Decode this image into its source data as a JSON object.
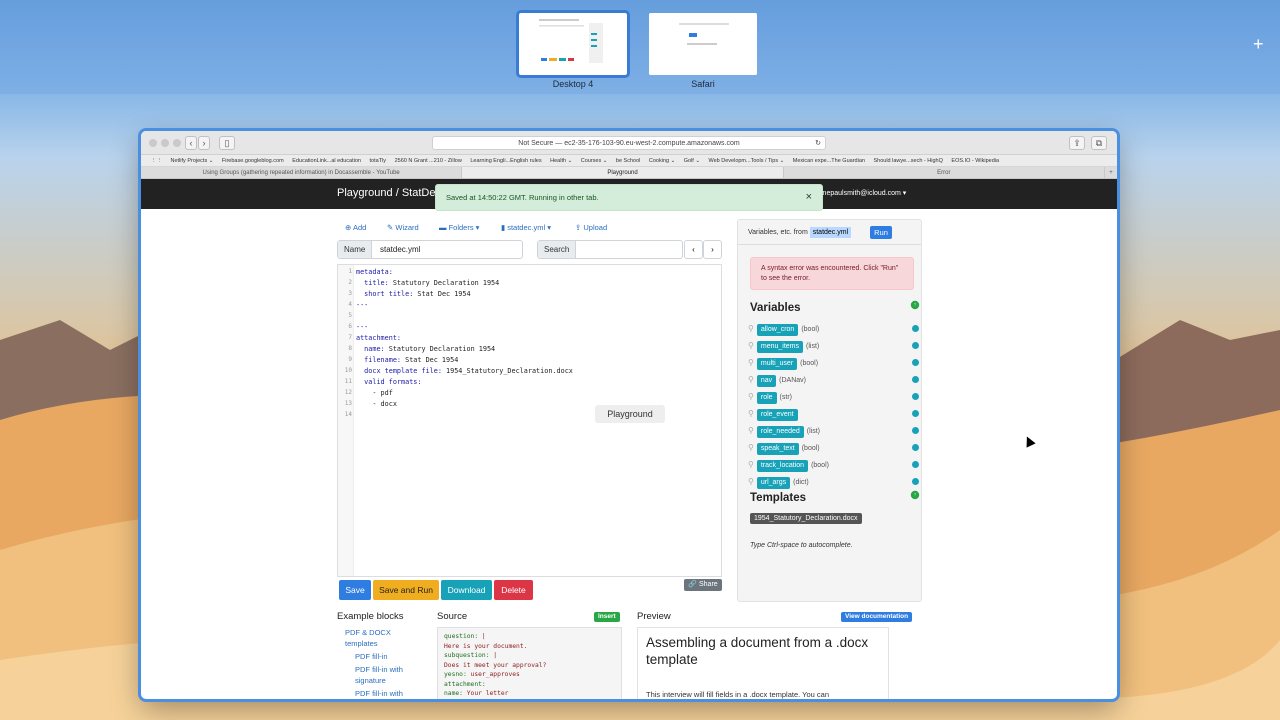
{
  "spaces": {
    "desktop_label": "Desktop 4",
    "safari_label": "Safari",
    "add_symbol": "+"
  },
  "browser": {
    "url": "Not Secure — ec2-35-176-103-90.eu-west-2.compute.amazonaws.com",
    "favorites": [
      "Netlify Projects ⌄",
      "Firebase.googleblog.com",
      "EducationLink...al education",
      "totaTly",
      "2560 N Grant ...210 - Zillow",
      "Learning Engli...English rules",
      "Health ⌄",
      "Courses ⌄",
      "be School",
      "Cooking ⌄",
      "Golf ⌄",
      "Web Developm...Tools / Tips ⌄",
      "Mexican expe...The Guardian",
      "Should lawye...sech - HighQ",
      "EOS.IO - Wikipedia"
    ],
    "tabs": [
      "Using Groups (gathering repeated information) in Docassemble - YouTube",
      "Playground",
      "Error"
    ]
  },
  "navbar": {
    "brand": "Playground / StatDec",
    "user": "inepaulsmith@icloud.com ▾"
  },
  "toast": {
    "message": "Saved at 14:50:22 GMT. Running in other tab.",
    "close": "×"
  },
  "toolbar": {
    "add": "Add",
    "wizard": "Wizard",
    "folders": "Folders ▾",
    "file": "statdec.yml ▾",
    "upload": "Upload"
  },
  "name_field": {
    "label": "Name",
    "value": "statdec.yml"
  },
  "search_field": {
    "label": "Search",
    "value": ""
  },
  "editor": {
    "lines": [
      {
        "n": "1",
        "k": "metadata:",
        "v": ""
      },
      {
        "n": "2",
        "k": "  title:",
        "v": " Statutory Declaration 1954"
      },
      {
        "n": "3",
        "k": "  short title:",
        "v": " Stat Dec 1954"
      },
      {
        "n": "4",
        "k": "---",
        "v": ""
      },
      {
        "n": "5",
        "k": "",
        "v": ""
      },
      {
        "n": "6",
        "k": "---",
        "v": ""
      },
      {
        "n": "7",
        "k": "attachment:",
        "v": ""
      },
      {
        "n": "8",
        "k": "  name:",
        "v": " Statutory Declaration 1954"
      },
      {
        "n": "9",
        "k": "  filename:",
        "v": " Stat Dec 1954"
      },
      {
        "n": "10",
        "k": "  docx template file:",
        "v": " 1954_Statutory_Declaration.docx"
      },
      {
        "n": "11",
        "k": "  valid formats:",
        "v": ""
      },
      {
        "n": "12",
        "k": "",
        "v": "    - pdf"
      },
      {
        "n": "13",
        "k": "",
        "v": "    - docx"
      },
      {
        "n": "14",
        "k": "",
        "v": ""
      }
    ],
    "tooltip": "Playground"
  },
  "buttons": {
    "save": "Save",
    "save_run": "Save and Run",
    "download": "Download",
    "delete": "Delete",
    "share": "Share"
  },
  "sidebar": {
    "head_text": "Variables, etc. from",
    "file_chip": "statdec.yml",
    "run": "Run",
    "alert": "A syntax error was encountered. Click \"Run\" to see the error.",
    "variables_title": "Variables",
    "variables": [
      {
        "name": "allow_cron",
        "type": "(bool)"
      },
      {
        "name": "menu_items",
        "type": "(list)"
      },
      {
        "name": "multi_user",
        "type": "(bool)"
      },
      {
        "name": "nav",
        "type": "(DANav)"
      },
      {
        "name": "role",
        "type": "(str)"
      },
      {
        "name": "role_event",
        "type": ""
      },
      {
        "name": "role_needed",
        "type": "(list)"
      },
      {
        "name": "speak_text",
        "type": "(bool)"
      },
      {
        "name": "track_location",
        "type": "(bool)"
      },
      {
        "name": "url_args",
        "type": "(dict)"
      }
    ],
    "templates_title": "Templates",
    "template_file": "1954_Statutory_Declaration.docx",
    "hint": "Type Ctrl-space to autocomplete."
  },
  "examples": {
    "title": "Example blocks",
    "category": "PDF & DOCX templates",
    "items": [
      "PDF fill-in",
      "PDF fill-in with signature",
      "PDF fill-in with"
    ]
  },
  "source": {
    "title": "Source",
    "insert": "Insert",
    "lines": [
      {
        "k": "question:",
        "v": " |"
      },
      {
        "k": "",
        "v": "  Here is your document."
      },
      {
        "k": "subquestion:",
        "v": " |"
      },
      {
        "k": "",
        "v": "  Does it meet your approval?"
      },
      {
        "k": "yesno:",
        "v": " user_approves"
      },
      {
        "k": "attachment:",
        "v": ""
      },
      {
        "k": "  name:",
        "v": " Your letter"
      }
    ]
  },
  "preview": {
    "title": "Preview",
    "view_doc": "View documentation",
    "heading": "Assembling a document from a .docx template",
    "body": "This interview will fill fields in a .docx template. You can"
  },
  "colors": {
    "save": "#2f7de1",
    "save_run": "#f0ad1f",
    "download": "#17a2b8",
    "delete": "#dc3545",
    "variable_badge": "#17a2b8"
  }
}
